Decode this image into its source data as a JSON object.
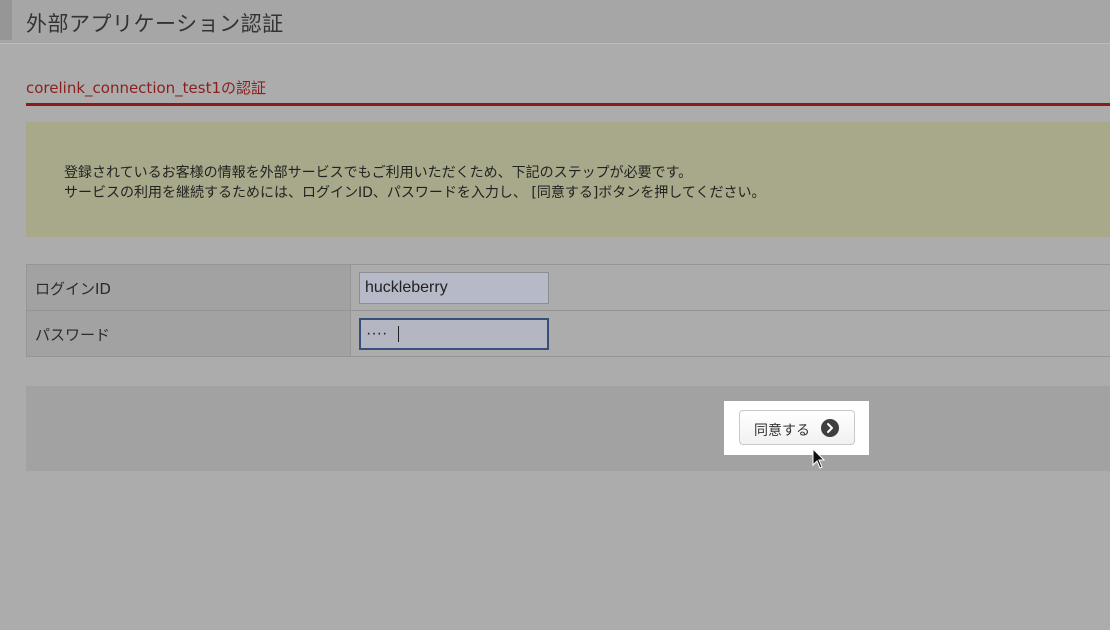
{
  "header": {
    "title": "外部アプリケーション認証"
  },
  "section": {
    "title": "corelink_connection_test1の認証"
  },
  "notice": {
    "line1": "登録されているお客様の情報を外部サービスでもご利用いただくため、下記のステップが必要です。",
    "line2": "サービスの利用を継続するためには、ログインID、パスワードを入力し、 [同意する]ボタンを押してください。"
  },
  "form": {
    "login_label": "ログインID",
    "login_value": "huckleberry",
    "password_label": "パスワード",
    "password_mask": "····"
  },
  "actions": {
    "agree_label": "同意する",
    "agree_icon": "arrow-right-circle-icon"
  },
  "colors": {
    "section_title": "#8a1f1f",
    "section_rule": "#8c1c1c",
    "notice_bg": "#a8a98a",
    "button_icon": "#3f3f3f"
  }
}
